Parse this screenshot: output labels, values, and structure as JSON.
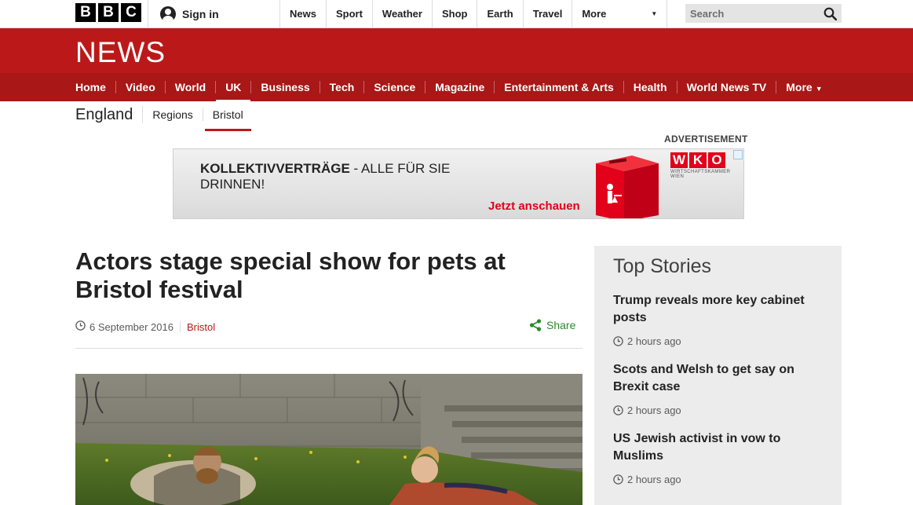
{
  "brand": {
    "logo_letters": [
      "B",
      "B",
      "C"
    ]
  },
  "topbar": {
    "signin_label": "Sign in",
    "nav": [
      "News",
      "Sport",
      "Weather",
      "Shop",
      "Earth",
      "Travel"
    ],
    "more_label": "More",
    "search_placeholder": "Search"
  },
  "banner": {
    "title": "NEWS"
  },
  "main_nav": {
    "items": [
      "Home",
      "Video",
      "World",
      "UK",
      "Business",
      "Tech",
      "Science",
      "Magazine",
      "Entertainment & Arts",
      "Health",
      "World News TV"
    ],
    "active": "UK",
    "more_label": "More"
  },
  "sub_nav": {
    "title": "England",
    "items": [
      "Regions",
      "Bristol"
    ],
    "active": "Bristol"
  },
  "ad": {
    "label": "ADVERTISEMENT",
    "headline_bold": "KOLLEKTIVVERTRÄGE",
    "headline_rest": " - ALLE FÜR SIE",
    "headline_line2": "DRINNEN!",
    "cta": "Jetzt anschauen",
    "logo_letters": [
      "W",
      "K",
      "O"
    ],
    "logo_sub": "WIRTSCHAFTSKAMMER WIEN",
    "brand_color": "#e2001a"
  },
  "article": {
    "headline": "Actors stage special show for pets at Bristol festival",
    "date": "6 September 2016",
    "section": "Bristol",
    "share_label": "Share"
  },
  "top_stories": {
    "title": "Top Stories",
    "items": [
      {
        "title": "Trump reveals more key cabinet posts",
        "time": "2 hours ago"
      },
      {
        "title": "Scots and Welsh to get say on Brexit case",
        "time": "2 hours ago"
      },
      {
        "title": "US Jewish activist in vow to Muslims",
        "time": "2 hours ago"
      }
    ]
  },
  "colors": {
    "bbc_red": "#bb1919",
    "nav_red": "#a91717",
    "share_green": "#2b8a2b"
  }
}
